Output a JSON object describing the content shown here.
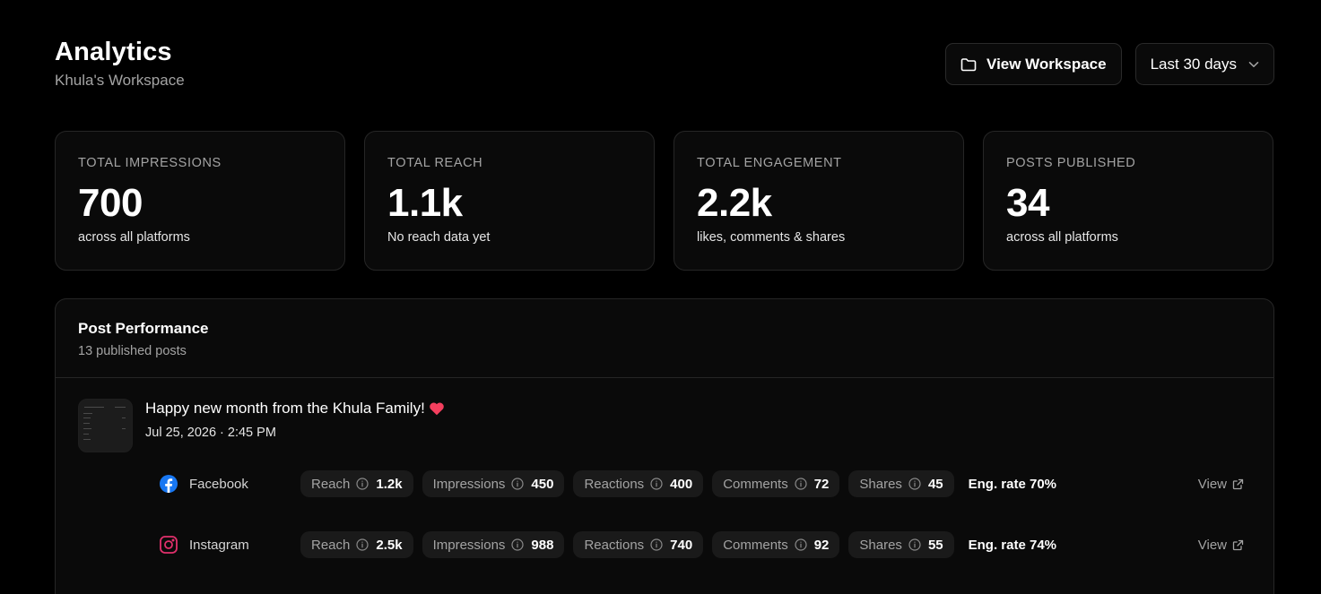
{
  "header": {
    "title": "Analytics",
    "subtitle": "Khula's Workspace",
    "view_workspace_label": "View Workspace",
    "range_label": "Last 30 days"
  },
  "stats": [
    {
      "label": "TOTAL IMPRESSIONS",
      "value": "700",
      "desc": "across all platforms"
    },
    {
      "label": "TOTAL REACH",
      "value": "1.1k",
      "desc": "No reach data yet"
    },
    {
      "label": "TOTAL ENGAGEMENT",
      "value": "2.2k",
      "desc": "likes, comments & shares"
    },
    {
      "label": "POSTS PUBLISHED",
      "value": "34",
      "desc": "across all platforms"
    }
  ],
  "performance": {
    "title": "Post Performance",
    "subtitle": "13 published posts",
    "post": {
      "title": "Happy new month from the Khula Family!",
      "date": "Jul 25, 2026 · 2:45 PM",
      "platforms": [
        {
          "name": "Facebook",
          "icon": "facebook-icon",
          "metrics": [
            {
              "label": "Reach",
              "value": "1.2k"
            },
            {
              "label": "Impressions",
              "value": "450"
            },
            {
              "label": "Reactions",
              "value": "400"
            },
            {
              "label": "Comments",
              "value": "72"
            },
            {
              "label": "Shares",
              "value": "45"
            }
          ],
          "eng_rate": "Eng. rate 70%",
          "view_label": "View"
        },
        {
          "name": "Instagram",
          "icon": "instagram-icon",
          "metrics": [
            {
              "label": "Reach",
              "value": "2.5k"
            },
            {
              "label": "Impressions",
              "value": "988"
            },
            {
              "label": "Reactions",
              "value": "740"
            },
            {
              "label": "Comments",
              "value": "92"
            },
            {
              "label": "Shares",
              "value": "55"
            }
          ],
          "eng_rate": "Eng. rate 74%",
          "view_label": "View"
        }
      ]
    }
  },
  "colors": {
    "background": "#000000",
    "card": "#0a0a0a",
    "border": "#262626",
    "chip": "#1a1a1a",
    "muted": "#a3a3a3",
    "facebook": "#1877f2",
    "instagram": "#e1306c",
    "heart": "#f43f5e"
  }
}
